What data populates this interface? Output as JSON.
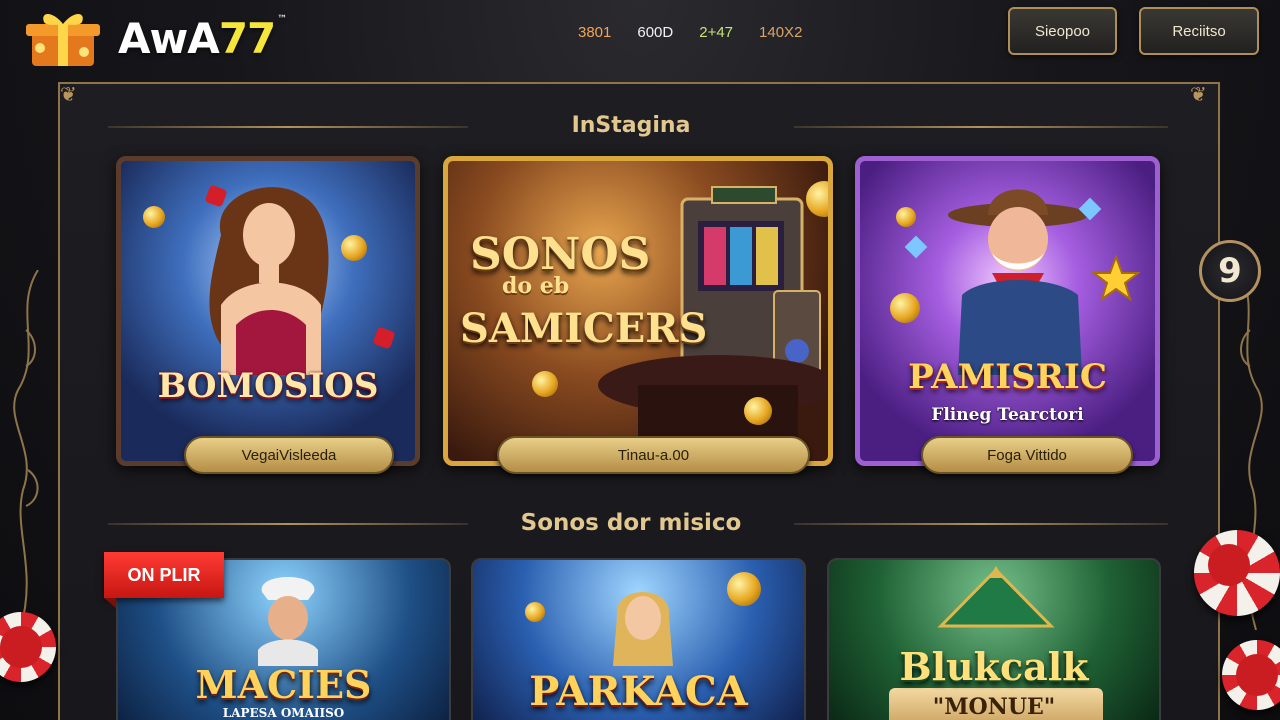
{
  "header": {
    "logo_main": "AwA",
    "logo_num": "77",
    "logo_tm": "™",
    "stats": [
      "3801",
      "600D",
      "2+47",
      "140X2"
    ],
    "buttons": {
      "login": "Sieopoo",
      "register": "Reciitso"
    }
  },
  "sections": {
    "top_title": "InStagina",
    "bottom_title": "Sonos dor misico"
  },
  "top_cards": [
    {
      "art_title": "BOMOSIOS",
      "button": "VegaiVisleeda"
    },
    {
      "art_title_line1": "SONOS",
      "art_title_line2": "do eb",
      "art_title_line3": "SAMICERS",
      "button": "Tinau-a.00"
    },
    {
      "art_title": "PAMISRIC",
      "art_subtitle": "Flineg Tearctori",
      "button": "Foga Vittido"
    }
  ],
  "side_badge": "9",
  "bottom_cards": [
    {
      "ribbon": "ON PLIR",
      "art_title": "MACIES",
      "art_subtitle": "LAPESA OMAIISO"
    },
    {
      "art_title": "PARKACA"
    },
    {
      "art_title": "Blukcalk",
      "art_subtitle": "\"MONUE\""
    }
  ],
  "colors": {
    "accent_gold": "#b2925c",
    "ribbon_red": "#e0231c",
    "logo_yellow": "#f6e53a"
  },
  "icons": [
    "gift-box-icon",
    "coin-icon",
    "dice-icon",
    "poker-chip-icon",
    "gem-icon"
  ]
}
